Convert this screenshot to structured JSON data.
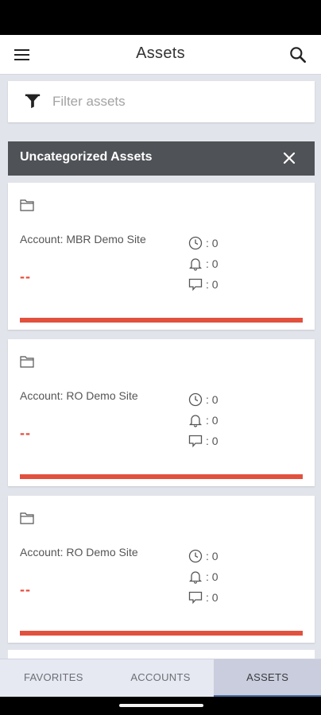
{
  "header": {
    "title": "Assets",
    "menu_icon": "hamburger-menu-icon",
    "search_icon": "search-icon"
  },
  "filter": {
    "placeholder": "Filter assets",
    "icon": "filter-funnel-icon"
  },
  "group": {
    "title": "Uncategorized Assets",
    "close_icon": "close-icon"
  },
  "assets": [
    {
      "account": "Account: MBR Demo Site",
      "status": "--",
      "clock_count": ": 0",
      "bell_count": ": 0",
      "chat_count": ": 0"
    },
    {
      "account": "Account: RO Demo Site",
      "status": "--",
      "clock_count": ": 0",
      "bell_count": ": 0",
      "chat_count": ": 0"
    },
    {
      "account": "Account: RO Demo Site",
      "status": "--",
      "clock_count": ": 0",
      "bell_count": ": 0",
      "chat_count": ": 0"
    }
  ],
  "bottom_nav": {
    "tabs": [
      "FAVORITES",
      "ACCOUNTS",
      "ASSETS"
    ],
    "active": "ASSETS"
  },
  "colors": {
    "accent_red": "#e2513e",
    "group_header": "#4f5256",
    "active_tab": "#c9cddd"
  }
}
